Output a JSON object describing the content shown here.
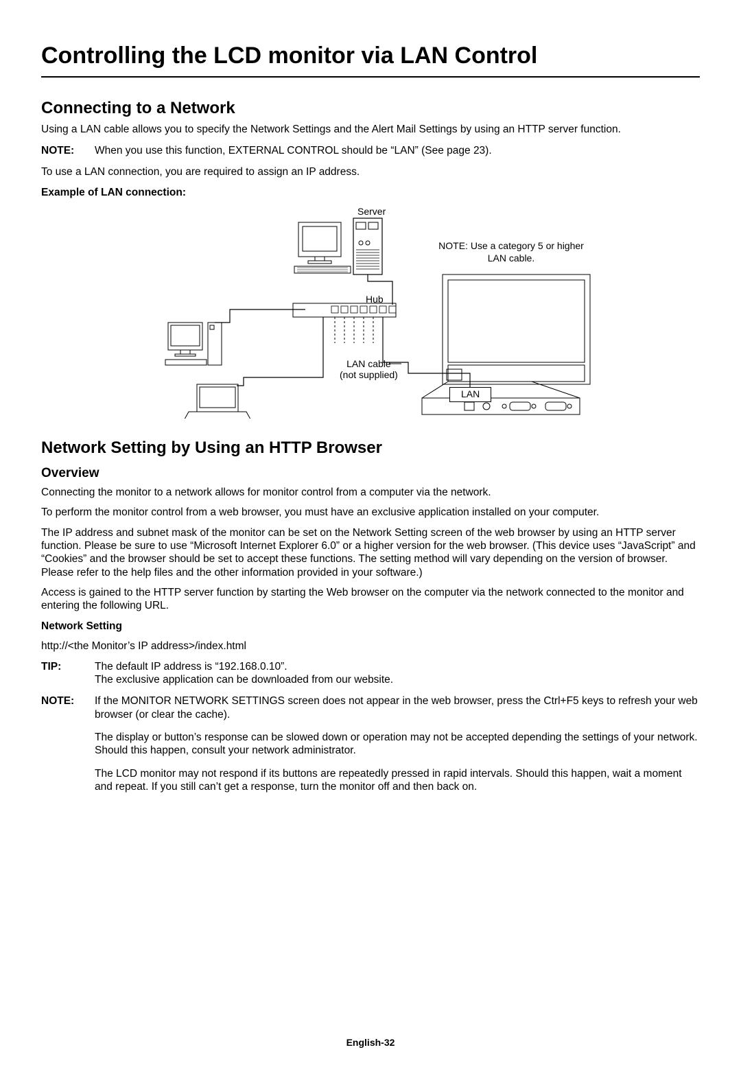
{
  "title": "Controlling the LCD monitor via LAN Control",
  "section1": {
    "heading": "Connecting to a Network",
    "intro": "Using a LAN cable allows you to specify the Network Settings and the Alert Mail Settings by using an HTTP server function.",
    "note_label": "NOTE:",
    "note_text": "When you use this function, EXTERNAL CONTROL should be “LAN” (See page 23).",
    "ip_req": "To use a LAN connection, you are required to assign an IP address.",
    "example_label": "Example of LAN connection:"
  },
  "diagram": {
    "server": "Server",
    "hub": "Hub",
    "cable1": "LAN cable",
    "cable2": "(not supplied)",
    "lan": "LAN",
    "note": "NOTE: Use a category 5 or higher LAN cable."
  },
  "section2": {
    "heading": "Network Setting by Using an HTTP Browser",
    "overview_heading": "Overview",
    "p1": "Connecting the monitor to a network allows for monitor control from a computer via the network.",
    "p2": "To perform the monitor control from a web browser, you must have an exclusive application installed on your computer.",
    "p3": "The IP address and subnet mask of the monitor can be set on the Network Setting screen of the web browser by using an HTTP server function. Please be sure to use “Microsoft Internet Explorer 6.0” or a higher version for the web browser. (This device uses “JavaScript” and “Cookies” and the browser should be set to accept these functions. The setting method will vary depending on the version of browser. Please refer to the help files and the other information provided in your software.)",
    "p4": "Access is gained to the HTTP server function by starting the Web browser on the computer via the network connected to the monitor and entering the following URL.",
    "net_setting_label": "Network Setting",
    "url": "http://<the Monitor’s IP address>/index.html",
    "tip_label": "TIP:",
    "tip_line1": "The default IP address is “192.168.0.10”.",
    "tip_line2": "The exclusive application can be downloaded from our website.",
    "note2_label": "NOTE:",
    "note2_p1": "If the MONITOR NETWORK SETTINGS screen does not appear in the web browser, press the Ctrl+F5 keys to refresh your web browser (or clear the cache).",
    "note2_p2": "The display or button’s response can be slowed down or operation may not be accepted depending the settings of your network. Should this happen, consult your network administrator.",
    "note2_p3": "The LCD monitor may not respond if its buttons are repeatedly pressed in rapid intervals. Should this happen, wait a moment and repeat. If you still can’t get a response, turn the monitor off and then back on."
  },
  "footer": "English-32"
}
